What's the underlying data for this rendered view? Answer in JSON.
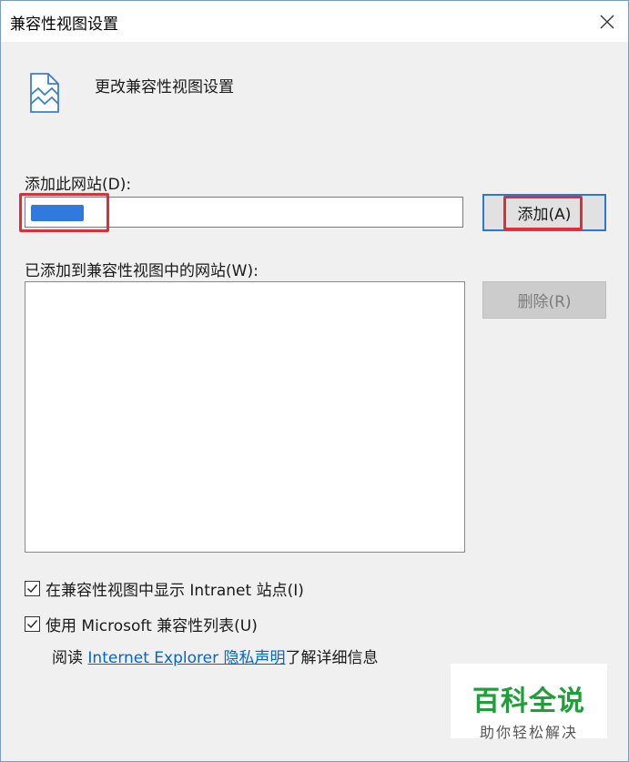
{
  "window": {
    "title": "兼容性视图设置",
    "close_symbol": "✕"
  },
  "header": {
    "icon": "compat-view-icon",
    "text": "更改兼容性视图设置"
  },
  "add_site": {
    "label": "添加此网站(D):",
    "input_value": "",
    "add_button_label": "添加(A)"
  },
  "site_list": {
    "label": "已添加到兼容性视图中的网站(W):",
    "items": [],
    "delete_button_label": "删除(R)"
  },
  "options": {
    "intranet_label": "在兼容性视图中显示 Intranet 站点(I)",
    "intranet_checked": true,
    "ms_list_label": "使用 Microsoft 兼容性列表(U)",
    "ms_list_checked": true
  },
  "privacy": {
    "prefix": "阅读 ",
    "link_text": "Internet Explorer 隐私声明",
    "suffix": "了解详细信息"
  },
  "watermark": {
    "title": "百科全说",
    "subtitle": "助你轻松解决"
  },
  "colors": {
    "highlight_red": "#d9303a",
    "accent_blue": "#2b78d4",
    "watermark_green": "#1f9e3a"
  }
}
